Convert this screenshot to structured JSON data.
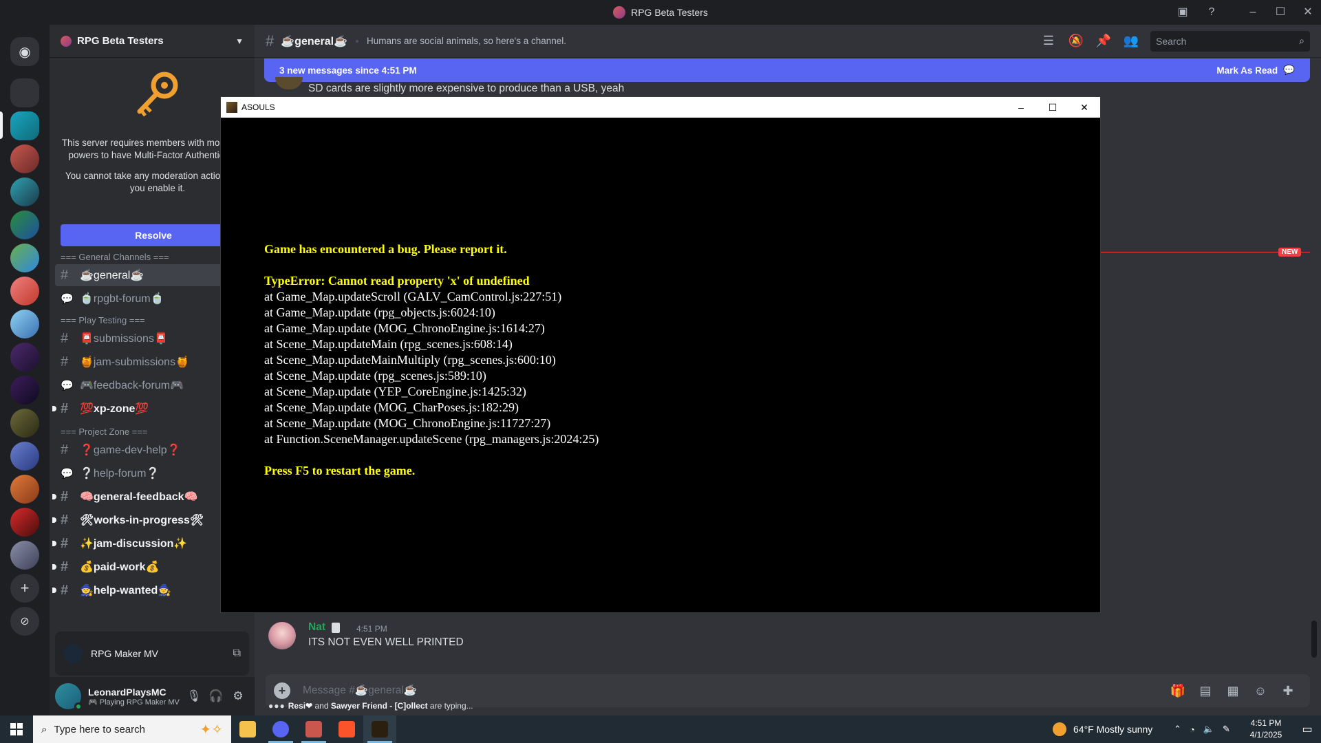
{
  "window": {
    "title": "RPG Beta Testers"
  },
  "sidebar": {
    "server_name": "RPG Beta Testers",
    "mfa_notice": "This server requires members with moderation powers to have Multi-Factor Authentication.",
    "mfa_notice_2": "You cannot take any moderation actions until you enable it.",
    "resolve_label": "Resolve",
    "category_general": "=== General Channels ===",
    "category_play_testing": "=== Play Testing ===",
    "category_project_zone": "=== Project Zone ===",
    "channels": [
      {
        "name": "☕general☕"
      },
      {
        "name": "🍵rpgbt-forum🍵"
      },
      {
        "name": "📮submissions📮"
      },
      {
        "name": "🍯jam-submissions🍯"
      },
      {
        "name": "🎮feedback-forum🎮"
      },
      {
        "name": "💯xp-zone💯"
      },
      {
        "name": "❓game-dev-help❓"
      },
      {
        "name": "❔help-forum❔"
      },
      {
        "name": "🧠general-feedback🧠"
      },
      {
        "name": "🛠works-in-progress🛠"
      },
      {
        "name": "✨jam-discussion✨"
      },
      {
        "name": "💰paid-work💰"
      },
      {
        "name": "🧙help-wanted🧙"
      }
    ],
    "activity_label": "RPG Maker MV",
    "user": {
      "name": "LeonardPlaysMC",
      "status": "🎮 Playing RPG Maker MV"
    }
  },
  "header": {
    "channel_name": "☕general☕",
    "topic": "Humans are social animals, so here's a channel.",
    "search_placeholder": "Search"
  },
  "banner": {
    "text": "3 new messages since 4:51 PM",
    "action": "Mark As Read"
  },
  "messages": {
    "top_fragment": "SD cards are slightly more expensive to produce than a USB, yeah",
    "new_badge": "NEW",
    "last": {
      "author": "Nat",
      "time": "4:51 PM",
      "text": "ITS NOT EVEN WELL PRINTED"
    }
  },
  "composer": {
    "placeholder": "Message #☕general☕"
  },
  "typing": {
    "user1": "Resi❤",
    "and": "and",
    "user2": "Sawyer Friend - [C]ollect",
    "suffix": "are typing..."
  },
  "game_window": {
    "title": "ASOULS",
    "line1": "Game has encountered a bug. Please report it.",
    "error": "TypeError: Cannot read property 'x' of undefined",
    "stack": [
      "at Game_Map.updateScroll (GALV_CamControl.js:227:51)",
      "at Game_Map.update (rpg_objects.js:6024:10)",
      "at Game_Map.update (MOG_ChronoEngine.js:1614:27)",
      "at Scene_Map.updateMain (rpg_scenes.js:608:14)",
      "at Scene_Map.updateMainMultiply (rpg_scenes.js:600:10)",
      "at Scene_Map.update (rpg_scenes.js:589:10)",
      "at Scene_Map.update (YEP_CoreEngine.js:1425:32)",
      "at Scene_Map.update (MOG_CharPoses.js:182:29)",
      "at Scene_Map.update (MOG_ChronoEngine.js:11727:27)",
      "at Function.SceneManager.updateScene (rpg_managers.js:2024:25)"
    ],
    "restart": "Press F5 to restart the game."
  },
  "taskbar": {
    "search_placeholder": "Type here to search",
    "weather": "64°F  Mostly sunny",
    "time": "4:51 PM",
    "date": "4/1/2025"
  },
  "colors": {
    "accent": "#5865f2",
    "online": "#23a55a",
    "error_yellow": "#ffff00",
    "new_red": "#f23f43"
  }
}
